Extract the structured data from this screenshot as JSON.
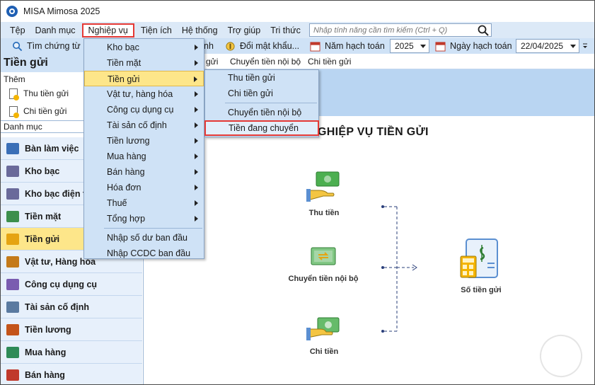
{
  "window": {
    "title": "MISA Mimosa 2025"
  },
  "menubar": {
    "items": [
      "Tệp",
      "Danh mục",
      "Nghiệp vụ",
      "Tiện ích",
      "Hệ thống",
      "Trợ giúp",
      "Tri thức"
    ],
    "search_placeholder": "Nhập tính năng cần tìm kiếm (Ctrl + Q)"
  },
  "toolbar": {
    "find_voucher": "Tìm chứng từ",
    "hidden_btn_tail": "nh",
    "change_password": "Đổi mật khẩu...",
    "fiscal_year_label": "Năm hạch toán",
    "fiscal_year_value": "2025",
    "posting_date_label": "Ngày hạch toán",
    "posting_date_value": "22/04/2025"
  },
  "sidebar": {
    "title": "Tiền gửi",
    "them": "Thêm",
    "add_items": [
      "Thu tiền gửi",
      "Chi tiền gửi"
    ],
    "danh_muc": "Danh mục",
    "nav": [
      {
        "label": "Bàn làm việc",
        "icon": "desk-icon",
        "color": "#3a6fb7"
      },
      {
        "label": "Kho bạc",
        "icon": "bank-icon",
        "color": "#6a6a9a"
      },
      {
        "label": "Kho bạc điện tử",
        "icon": "e-bank-icon",
        "color": "#6a6a9a"
      },
      {
        "label": "Tiền mặt",
        "icon": "cash-icon",
        "color": "#3c8f4c"
      },
      {
        "label": "Tiền gửi",
        "icon": "deposit-icon",
        "color": "#e5a412"
      },
      {
        "label": "Vật tư, Hàng hóa",
        "icon": "goods-icon",
        "color": "#c47a1a"
      },
      {
        "label": "Công cụ dụng cụ",
        "icon": "tools-icon",
        "color": "#7a5cb0"
      },
      {
        "label": "Tài sản cố định",
        "icon": "asset-icon",
        "color": "#5a7aa0"
      },
      {
        "label": "Tiền lương",
        "icon": "salary-icon",
        "color": "#c4541a"
      },
      {
        "label": "Mua hàng",
        "icon": "cart-icon",
        "color": "#2e8b57"
      },
      {
        "label": "Bán hàng",
        "icon": "sale-icon",
        "color": "#c0392b"
      }
    ]
  },
  "tabs": [
    "gửi",
    "Chuyển tiền nội bộ",
    "Chi tiền gửi"
  ],
  "dropdown": {
    "items": [
      "Kho bạc",
      "Tiền mặt",
      "Tiền gửi",
      "Vật tư, hàng hóa",
      "Công cụ dụng cụ",
      "Tài sản cố định",
      "Tiền lương",
      "Mua hàng",
      "Bán hàng",
      "Hóa đơn",
      "Thuế",
      "Tổng hợp",
      "Nhập số dư ban đầu",
      "Nhập CCDC ban đầu"
    ]
  },
  "submenu": {
    "items": [
      "Thu tiền gửi",
      "Chi tiền gửi",
      "Chuyển tiền nội bộ",
      "Tiền đang chuyển"
    ]
  },
  "main": {
    "title": "NGHIỆP VỤ TIỀN GỬI",
    "features": [
      "Thu tiền",
      "Chuyển tiền nội bộ",
      "Chi tiền",
      "Số tiền gửi"
    ]
  },
  "colors": {
    "accent": "#cfe2f6",
    "highlight": "#fde68a",
    "red_box": "#e53935"
  }
}
